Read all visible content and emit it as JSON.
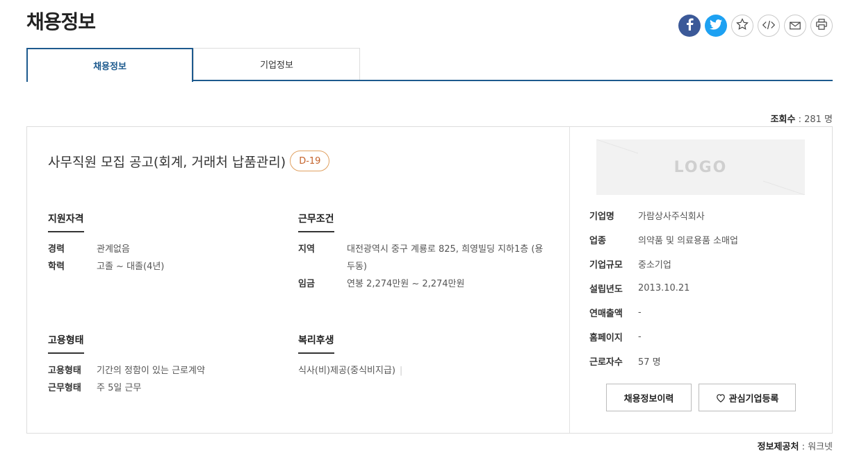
{
  "page": {
    "title": "채용정보"
  },
  "share": {
    "icons": [
      "facebook-icon",
      "twitter-icon",
      "star-icon",
      "embed-code-icon",
      "mail-icon",
      "print-icon"
    ],
    "colors": {
      "facebook": "#3b5998",
      "twitter": "#1da1f2"
    }
  },
  "tabs": [
    {
      "label": "채용정보",
      "active": true
    },
    {
      "label": "기업정보",
      "active": false
    }
  ],
  "views": {
    "label": "조회수",
    "value": ": 281 명"
  },
  "job": {
    "title": "사무직원 모집 공고(회계, 거래처 납품관리)",
    "dday": "D-19"
  },
  "qualifications": {
    "heading": "지원자격",
    "rows": [
      {
        "k": "경력",
        "v": "관계없음"
      },
      {
        "k": "학력",
        "v": "고졸 ~ 대졸(4년)"
      }
    ]
  },
  "conditions": {
    "heading": "근무조건",
    "rows": [
      {
        "k": "지역",
        "v": "대전광역시 중구 계룡로 825, 희영빌딩 지하1층 (용두동)"
      },
      {
        "k": "임금",
        "v": "연봉 2,274만원 ~ 2,274만원"
      }
    ]
  },
  "employment": {
    "heading": "고용형태",
    "rows": [
      {
        "k": "고용형태",
        "v": "기간의 정함이 있는 근로계약"
      },
      {
        "k": "근무형태",
        "v": "주 5일 근무"
      }
    ]
  },
  "welfare": {
    "heading": "복리후생",
    "items": [
      "식사(비)제공(중식비지급)"
    ]
  },
  "company": {
    "logo_text": "LOGO",
    "rows": [
      {
        "k": "기업명",
        "v": "가람상사주식회사"
      },
      {
        "k": "업종",
        "v": "의약품 및 의료용품 소매업"
      },
      {
        "k": "기업규모",
        "v": "중소기업"
      },
      {
        "k": "설립년도",
        "v": "2013.10.21"
      },
      {
        "k": "연매출액",
        "v": "-"
      },
      {
        "k": "홈페이지",
        "v": "-"
      },
      {
        "k": "근로자수",
        "v": "57 명"
      }
    ],
    "history_button": "채용정보이력",
    "interest_button": "관심기업등록"
  },
  "source": {
    "label": "정보제공처",
    "value": ": 워크넷"
  }
}
